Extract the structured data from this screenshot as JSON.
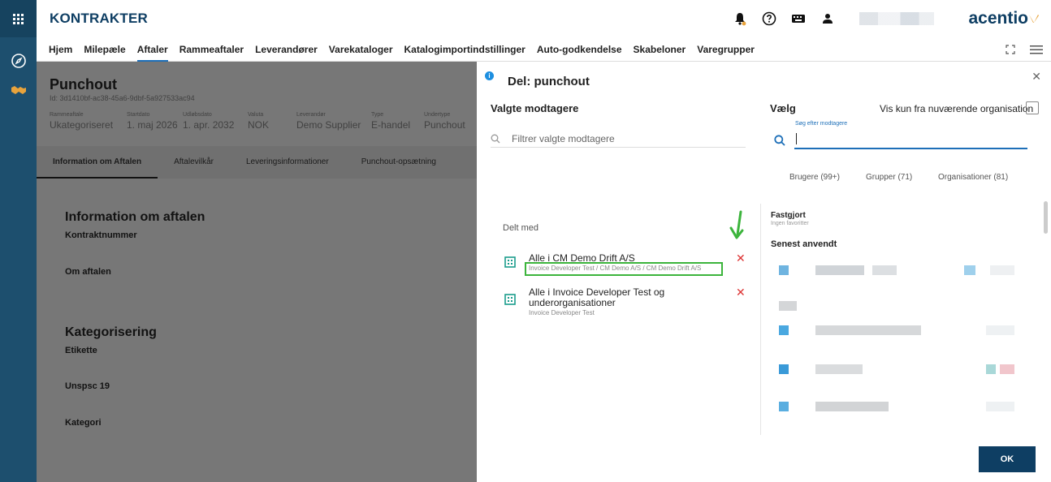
{
  "app": {
    "brand": "KONTRAKTER",
    "logo_text": "acentio"
  },
  "nav": {
    "items": [
      "Hjem",
      "Milepæle",
      "Aftaler",
      "Rammeaftaler",
      "Leverandører",
      "Varekataloger",
      "Katalogimportindstillinger",
      "Auto-godkendelse",
      "Skabeloner",
      "Varegrupper"
    ],
    "active": "Aftaler"
  },
  "agreement": {
    "title": "Punchout",
    "id": "Id: 3d1410bf-ac38-45a6-9dbf-5a927533ac94",
    "meta": [
      {
        "label": "Rammeaftale",
        "value": "Ukategoriseret"
      },
      {
        "label": "Startdato",
        "value": "1. maj 2026"
      },
      {
        "label": "Udløbsdato",
        "value": "1. apr. 2032"
      },
      {
        "label": "Valuta",
        "value": "NOK"
      },
      {
        "label": "Leverandør",
        "value": "Demo Supplier"
      },
      {
        "label": "Type",
        "value": "E-handel"
      },
      {
        "label": "Undertype",
        "value": "Punchout"
      }
    ],
    "tabs": [
      "Information om Aftalen",
      "Aftalevilkår",
      "Leveringsinformationer",
      "Punchout-opsætning"
    ],
    "sections": {
      "info_title": "Information om aftalen",
      "contract_number": "Kontraktnummer",
      "about": "Om aftalen",
      "categorization": "Kategorisering",
      "label": "Etikette",
      "unspsc": "Unspsc 19",
      "category": "Kategori"
    }
  },
  "dialog": {
    "title": "Del: punchout",
    "selected_header": "Valgte modtagere",
    "filter_placeholder": "Filtrer valgte modtagere",
    "choose_header": "Vælg",
    "only_current_org": "Vis kun fra nuværende organisation",
    "search_label": "Søg efter modtagere",
    "subtabs": [
      "Brugere (99+)",
      "Grupper (71)",
      "Organisationer (81)"
    ],
    "shared_with": "Delt med",
    "shared_items": [
      {
        "name": "Alle i CM Demo Drift A/S",
        "path": "Invoice Developer Test / CM Demo A/S / CM Demo Drift A/S"
      },
      {
        "name": "Alle i Invoice Developer Test og underorganisationer",
        "path": "Invoice Developer Test"
      }
    ],
    "pinned_header": "Fastgjort",
    "pinned_empty": "Ingen favoritter",
    "recent_header": "Senest anvendt",
    "ok_label": "OK"
  }
}
